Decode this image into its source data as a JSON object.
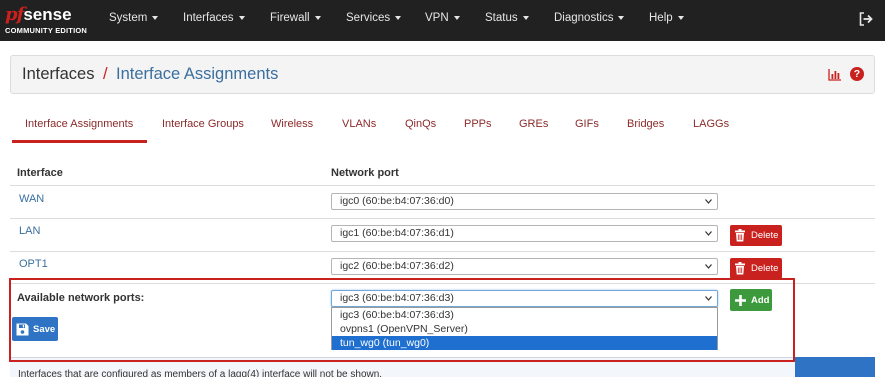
{
  "brand": {
    "logo_pf": "pf",
    "logo_sense": "sense",
    "edition": "COMMUNITY EDITION"
  },
  "nav": {
    "items": [
      {
        "label": "System"
      },
      {
        "label": "Interfaces"
      },
      {
        "label": "Firewall"
      },
      {
        "label": "Services"
      },
      {
        "label": "VPN"
      },
      {
        "label": "Status"
      },
      {
        "label": "Diagnostics"
      },
      {
        "label": "Help"
      }
    ],
    "logout_icon": "sign-out-icon"
  },
  "header": {
    "breadcrumb_root": "Interfaces",
    "separator": "/",
    "breadcrumb_current": "Interface Assignments",
    "icons": [
      "bar-chart-icon",
      "question-circle-icon"
    ]
  },
  "tabs": [
    {
      "label": "Interface Assignments",
      "active": true
    },
    {
      "label": "Interface Groups"
    },
    {
      "label": "Wireless"
    },
    {
      "label": "VLANs"
    },
    {
      "label": "QinQs"
    },
    {
      "label": "PPPs"
    },
    {
      "label": "GREs"
    },
    {
      "label": "GIFs"
    },
    {
      "label": "Bridges"
    },
    {
      "label": "LAGGs"
    }
  ],
  "table": {
    "col_interface": "Interface",
    "col_port": "Network port",
    "rows": [
      {
        "interface": "WAN",
        "port": "igc0 (60:be:b4:07:36:d0)"
      },
      {
        "interface": "LAN",
        "port": "igc1 (60:be:b4:07:36:d1)",
        "action": "Delete"
      },
      {
        "interface": "OPT1",
        "port": "igc2 (60:be:b4:07:36:d2)",
        "action": "Delete"
      }
    ]
  },
  "available": {
    "label": "Available network ports:",
    "selected": "igc3 (60:be:b4:07:36:d3)",
    "options": [
      "igc3 (60:be:b4:07:36:d3)",
      "ovpns1 (OpenVPN_Server)",
      "tun_wg0 (tun_wg0)"
    ],
    "highlighted_option": "tun_wg0 (tun_wg0)",
    "add_label": "Add"
  },
  "actions": {
    "save_label": "Save"
  },
  "footer_note": "Interfaces that are configured as members of a lagg(4) interface will not be shown.",
  "colors": {
    "navbar": "#212121",
    "brand_red": "#c9211e",
    "link_blue": "#3a6f9f",
    "delete_red": "#c9211e",
    "add_green": "#3c9a3c",
    "save_blue": "#2f73c5",
    "dropdown_select": "#1e6fcf"
  }
}
